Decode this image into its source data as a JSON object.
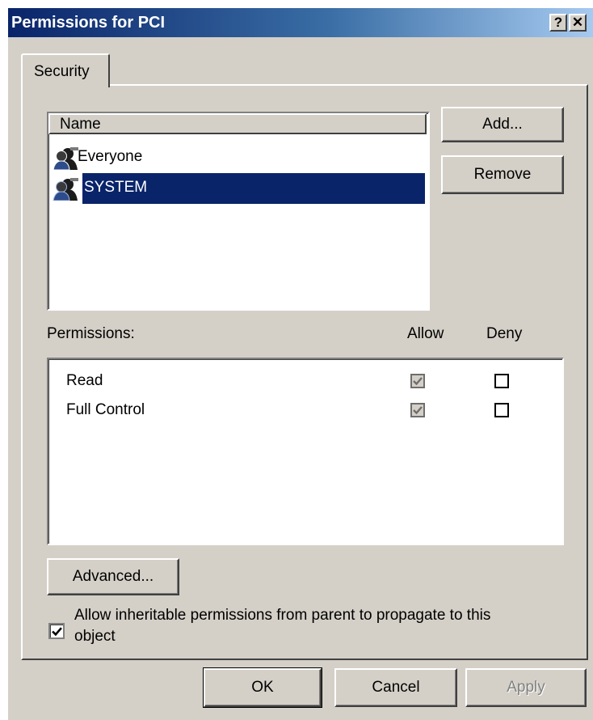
{
  "window": {
    "title": "Permissions for PCI",
    "help_label": "?",
    "close_label": "✕"
  },
  "tabs": [
    {
      "label": "Security",
      "selected": true
    }
  ],
  "names_list": {
    "header": "Name",
    "items": [
      {
        "label": "Everyone",
        "icon": "users-group-icon",
        "selected": false
      },
      {
        "label": "SYSTEM",
        "icon": "users-group-icon",
        "selected": true
      }
    ]
  },
  "buttons": {
    "add": "Add...",
    "remove": "Remove",
    "advanced": "Advanced...",
    "ok": "OK",
    "cancel": "Cancel",
    "apply": "Apply"
  },
  "permissions": {
    "label": "Permissions:",
    "allow_header": "Allow",
    "deny_header": "Deny",
    "rows": [
      {
        "name": "Read",
        "allow": true,
        "allow_disabled": true,
        "deny": false
      },
      {
        "name": "Full Control",
        "allow": true,
        "allow_disabled": true,
        "deny": false
      }
    ]
  },
  "inherit": {
    "checked": true,
    "label_line1": "Allow inheritable permissions from parent to propagate to this",
    "label_line2": "object"
  },
  "colors": {
    "face": "#d4d0c8",
    "selection": "#0a246a",
    "title_gradient_start": "#0a246a",
    "title_gradient_end": "#a6caf0"
  }
}
